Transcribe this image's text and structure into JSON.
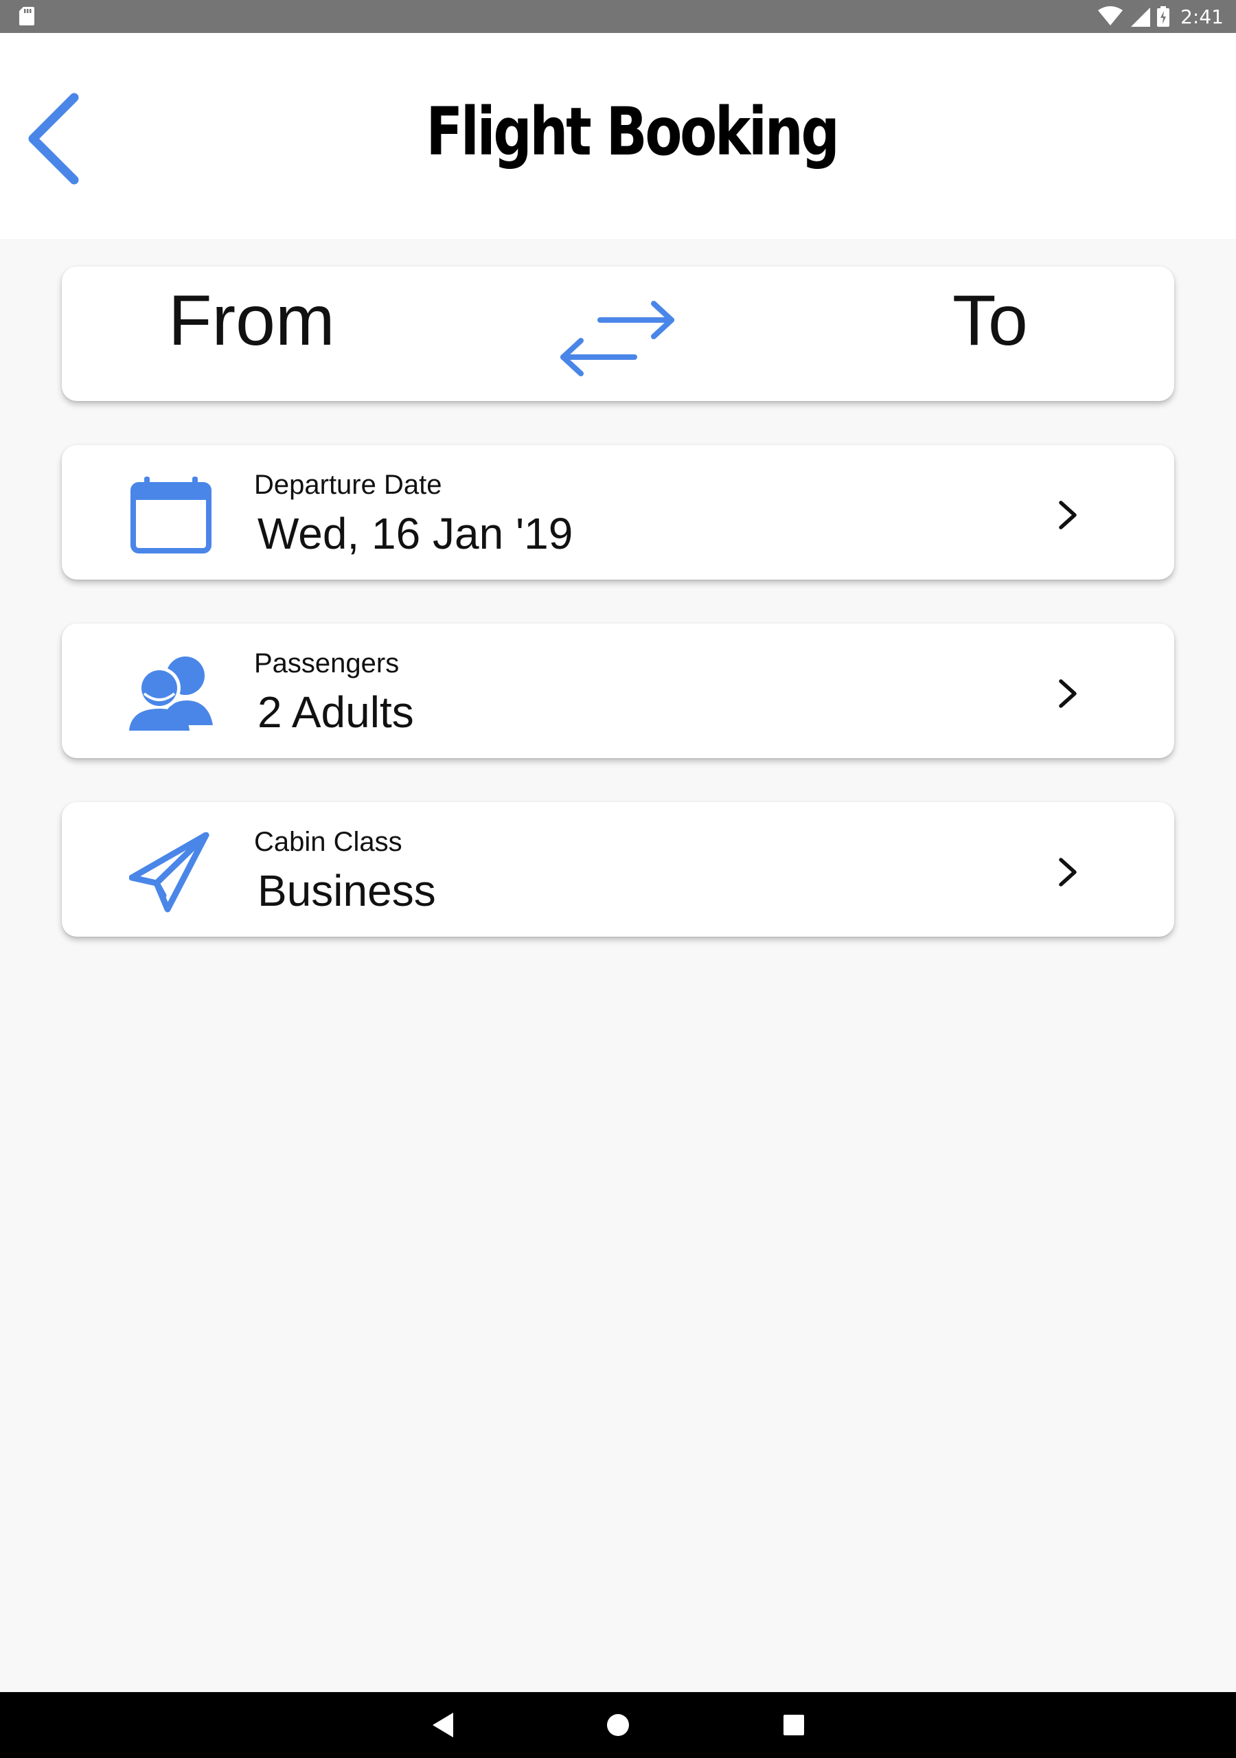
{
  "status_bar": {
    "time": "2:41",
    "icons": [
      "sd-card-icon",
      "wifi-icon",
      "signal-icon",
      "battery-charging-icon"
    ]
  },
  "header": {
    "title": "Flight Booking",
    "back_icon": "back-arrow-icon"
  },
  "route": {
    "from_label": "From",
    "to_label": "To",
    "swap_icon": "swap-arrows-icon"
  },
  "rows": [
    {
      "caption": "Departure Date",
      "value": "Wed, 16 Jan '19",
      "icon": "calendar-icon"
    },
    {
      "caption": "Passengers",
      "value": "2 Adults",
      "icon": "passengers-icon"
    },
    {
      "caption": "Cabin Class",
      "value": "Business",
      "icon": "paper-plane-icon"
    }
  ],
  "nav_bar": {
    "buttons": [
      "back-triangle-icon",
      "home-circle-icon",
      "recents-square-icon"
    ]
  },
  "colors": {
    "accent": "#4a86e8",
    "status_bar": "#757575",
    "background": "#f8f8f8",
    "card": "#ffffff",
    "nav_bar": "#000000"
  }
}
